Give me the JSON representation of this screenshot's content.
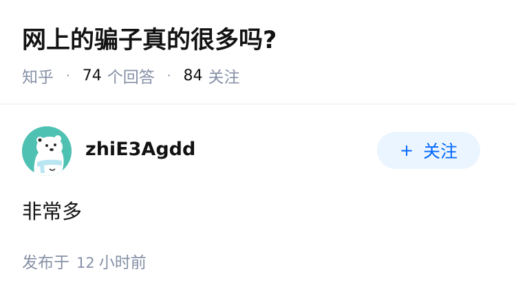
{
  "question": {
    "title": "网上的骗子真的很多吗?",
    "source": "知乎",
    "answer_count": "74",
    "answer_count_label": "个回答",
    "follow_count": "84",
    "follow_count_label": "关注",
    "separator": "·"
  },
  "answer": {
    "author": {
      "name": "zhiE3Agdd",
      "avatar_icon": "polar-bear-avatar-icon"
    },
    "follow_button": {
      "icon": "+",
      "label": "关注"
    },
    "content": "非常多",
    "time_prefix": "发布于",
    "time_value": "12",
    "time_unit": "小时前"
  },
  "colors": {
    "primary_text": "#121212",
    "secondary_text": "#8590a6",
    "accent_blue": "#0066ff",
    "follow_button_bg": "#ebf5ff",
    "avatar_bg": "#4fc1b3",
    "divider": "#ebebeb"
  }
}
